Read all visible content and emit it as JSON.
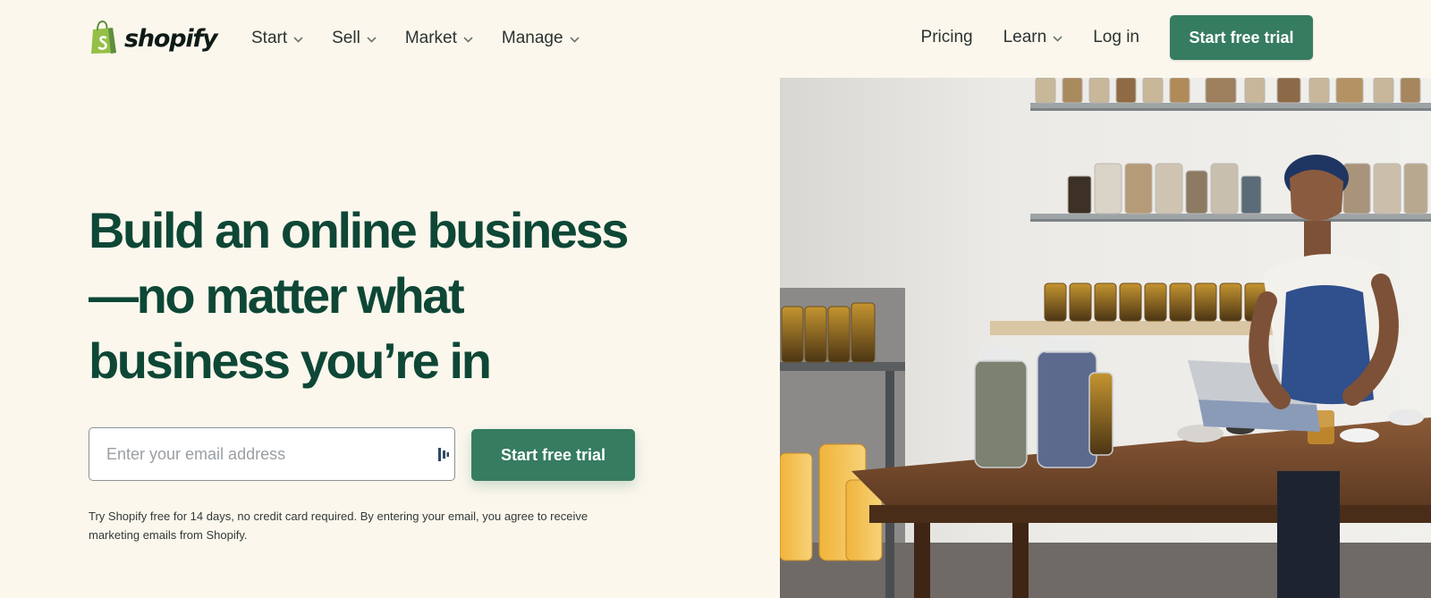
{
  "brand": {
    "name": "shopify",
    "logo_icon": "shopping-bag-icon",
    "accent_color": "#367c61",
    "heading_color": "#0e4736",
    "background_color": "#fbf7ed"
  },
  "nav": {
    "left": [
      {
        "label": "Start",
        "icon": "chevron-down-icon"
      },
      {
        "label": "Sell",
        "icon": "chevron-down-icon"
      },
      {
        "label": "Market",
        "icon": "chevron-down-icon"
      },
      {
        "label": "Manage",
        "icon": "chevron-down-icon"
      }
    ],
    "right": {
      "pricing": "Pricing",
      "learn": "Learn",
      "login": "Log in",
      "cta": "Start free trial"
    }
  },
  "hero": {
    "headline_lines": [
      "Build an online business",
      "—no matter what",
      "business you’re in"
    ],
    "email_placeholder": "Enter your email address",
    "cta": "Start free trial",
    "disclaimer": "Try Shopify free for 14 days, no credit card required. By entering your email, you agree to receive marketing emails from Shopify.",
    "image": {
      "subject": "woman in headscarf and denim apron using a tablet at a wooden table with glass jars of dried herbs and shelves of jars"
    }
  }
}
